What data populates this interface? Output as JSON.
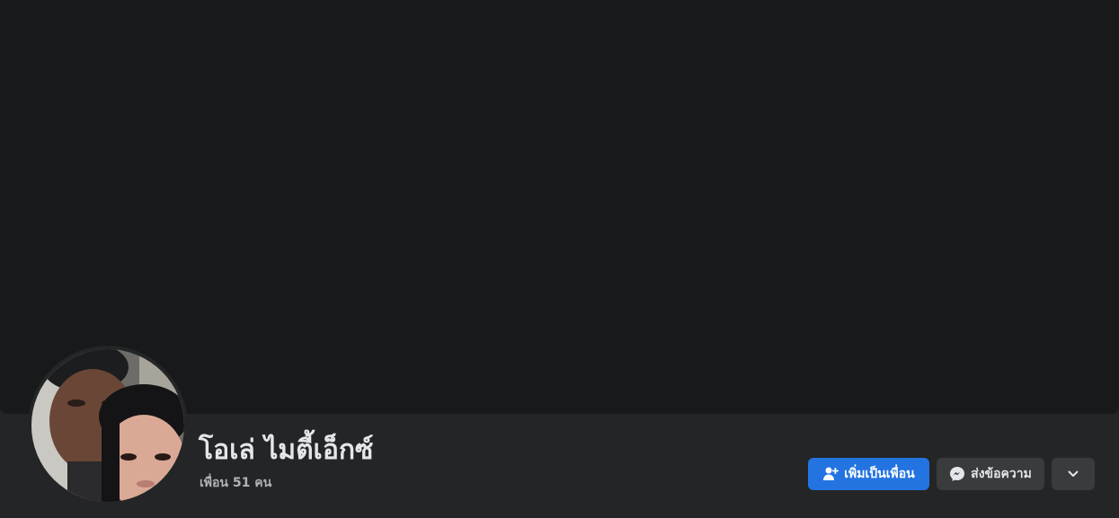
{
  "profile": {
    "name": "โอเล่ ไมตี้เอ็กซ์",
    "friends_text": "เพื่อน 51 คน"
  },
  "actions": {
    "add_friend_label": "เพิ่มเป็นเพื่อน",
    "message_label": "ส่งข้อความ"
  },
  "icons": {
    "add_friend": "user-plus-icon",
    "message": "messenger-icon",
    "more": "chevron-down-icon"
  },
  "colors": {
    "cover_bg": "#18191a",
    "page_bg": "#242526",
    "primary_button": "#2374e1",
    "secondary_button": "#3a3b3c"
  }
}
